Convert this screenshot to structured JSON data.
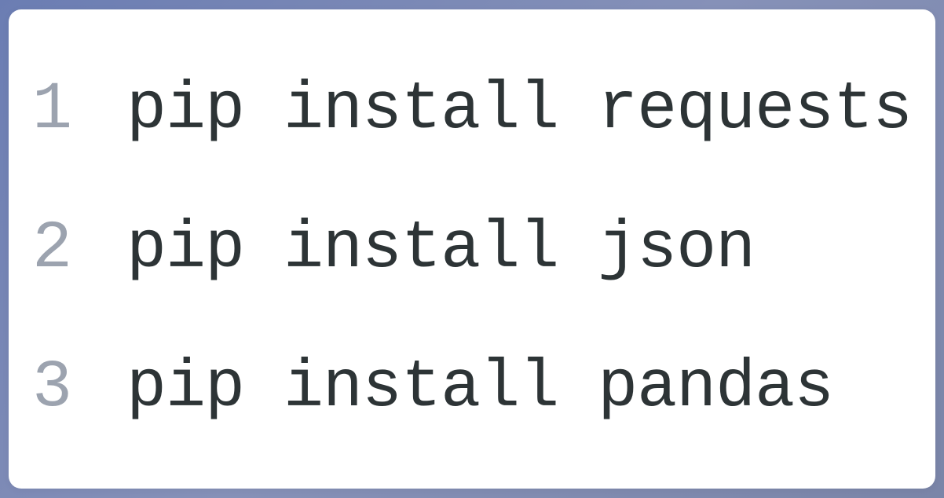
{
  "code": {
    "lines": [
      {
        "number": "1",
        "text": "pip install requests"
      },
      {
        "number": "2",
        "text": "pip install json"
      },
      {
        "number": "3",
        "text": "pip install pandas"
      }
    ]
  }
}
